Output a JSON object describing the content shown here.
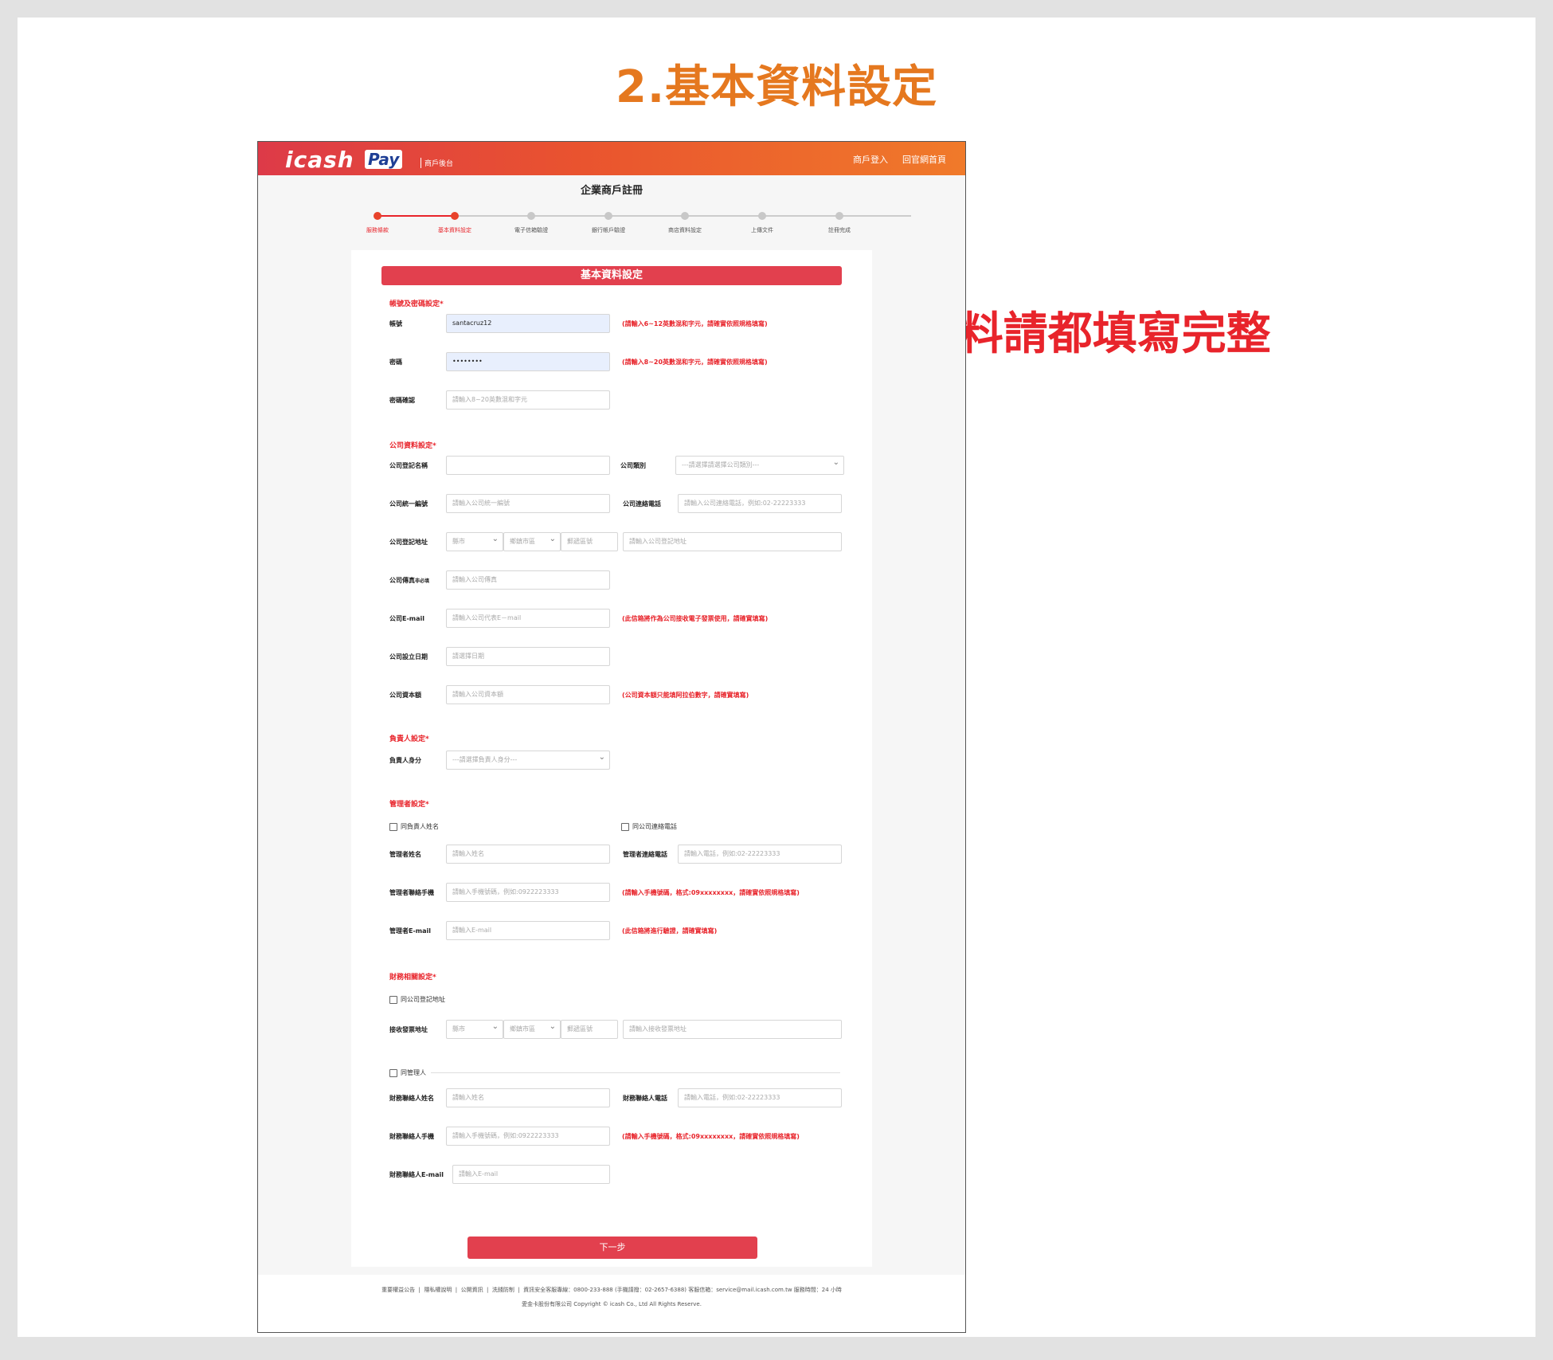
{
  "slide": {
    "title": "2.基本資料設定",
    "annotation": "← *資料請都填寫完整"
  },
  "header": {
    "logo_text": "icash",
    "logo_pay": "Pay",
    "logo_subtitle": "商戶後台",
    "links": [
      "商戶登入",
      "回官網首頁"
    ]
  },
  "page": {
    "title": "企業商戶註冊",
    "steps": [
      "服務條款",
      "基本資料設定",
      "電子信箱驗證",
      "銀行帳戶驗證",
      "商店資料設定",
      "上傳文件",
      "註冊完成"
    ],
    "current_step": 2
  },
  "form": {
    "banner": "基本資料設定",
    "account_section": "帳號及密碼設定*",
    "account_label": "帳號",
    "account_value": "santacruz12",
    "account_hint": "(請輸入6~12英數混和字元，請確實依照規格填寫)",
    "password_label": "密碼",
    "password_value": "••••••••",
    "password_hint": "(請輸入8~20英數混和字元，請確實依照規格填寫)",
    "password_confirm_label": "密碼確認",
    "password_confirm_placeholder": "請輸入8~20英數混和字元",
    "company_section": "公司資料設定*",
    "company_name_label": "公司登記名稱",
    "company_type_label": "公司類別",
    "company_type_placeholder": "---請選擇請選擇公司類別---",
    "tax_id_label": "公司統一編號",
    "tax_id_placeholder": "請輸入公司統一編號",
    "company_phone_label": "公司連絡電話",
    "company_phone_placeholder": "請輸入公司連絡電話，例如:02-22223333",
    "company_address_label": "公司登記地址",
    "city_placeholder": "縣市",
    "district_placeholder": "鄉鎮市區",
    "zip_placeholder": "郵遞區號",
    "company_address_placeholder": "請輸入公司登記地址",
    "fax_label": "公司傳真",
    "fax_optional": "非必填",
    "fax_placeholder": "請輸入公司傳真",
    "company_email_label": "公司E-mail",
    "company_email_placeholder": "請輸入公司代表E－mail",
    "company_email_hint": "(此信箱將作為公司接收電子發票使用，請確實填寫)",
    "founded_label": "公司設立日期",
    "founded_placeholder": "請選擇日期",
    "capital_label": "公司資本額",
    "capital_placeholder": "請輸入公司資本額",
    "capital_hint": "(公司資本額只能填阿拉伯數字，請確實填寫)",
    "owner_section": "負責人設定*",
    "owner_identity_label": "負責人身分",
    "owner_identity_placeholder": "---請選擇負責人身分---",
    "manager_section": "管理者設定*",
    "same_owner_name": "同負責人姓名",
    "same_company_phone": "同公司連絡電話",
    "manager_name_label": "管理者姓名",
    "manager_name_placeholder": "請輸入姓名",
    "manager_phone_label": "管理者連絡電話",
    "manager_phone_placeholder": "請輸入電話，例如:02-22223333",
    "manager_mobile_label": "管理者聯絡手機",
    "manager_mobile_placeholder": "請輸入手機號碼，例如:0922223333",
    "manager_mobile_hint": "(請輸入手機號碼，格式:09xxxxxxxx，請確實依照規格填寫)",
    "manager_email_label": "管理者E-mail",
    "manager_email_placeholder": "請輸入E-mail",
    "manager_email_hint": "(此信箱將進行驗證，請確實填寫)",
    "finance_section": "財務相關設定*",
    "same_company_address": "同公司登記地址",
    "invoice_address_label": "接收發票地址",
    "invoice_address_placeholder": "請輸入接收發票地址",
    "same_manager": "同管理人",
    "finance_name_label": "財務聯絡人姓名",
    "finance_name_placeholder": "請輸入姓名",
    "finance_phone_label": "財務聯絡人電話",
    "finance_phone_placeholder": "請輸入電話，例如:02-22223333",
    "finance_mobile_label": "財務聯絡人手機",
    "finance_mobile_placeholder": "請輸入手機號碼，例如:0922223333",
    "finance_mobile_hint": "(請輸入手機號碼，格式:09xxxxxxxx，請確實依照規格填寫)",
    "finance_email_label": "財務聯絡人E-mail",
    "finance_email_placeholder": "請輸入E-mail",
    "next_button": "下一步"
  },
  "footer": {
    "links": [
      "重要權益公告",
      "隱私權說明",
      "公開資訊",
      "洗錢防制"
    ],
    "contact": "資訊安全客服專線：0800-233-888 (手機請撥：02-2657-6388) 客服信箱：service@mail.icash.com.tw 服務時間：24 小時",
    "copyright": "愛金卡股份有限公司 Copyright © icash Co., Ltd All Rights Reserve."
  },
  "colors": {
    "slide_title": "#e5781f",
    "annotation": "#e8242b",
    "brand_red": "#e2404e",
    "brand_orange": "#f07a2a",
    "hint_red": "#e8242b"
  }
}
